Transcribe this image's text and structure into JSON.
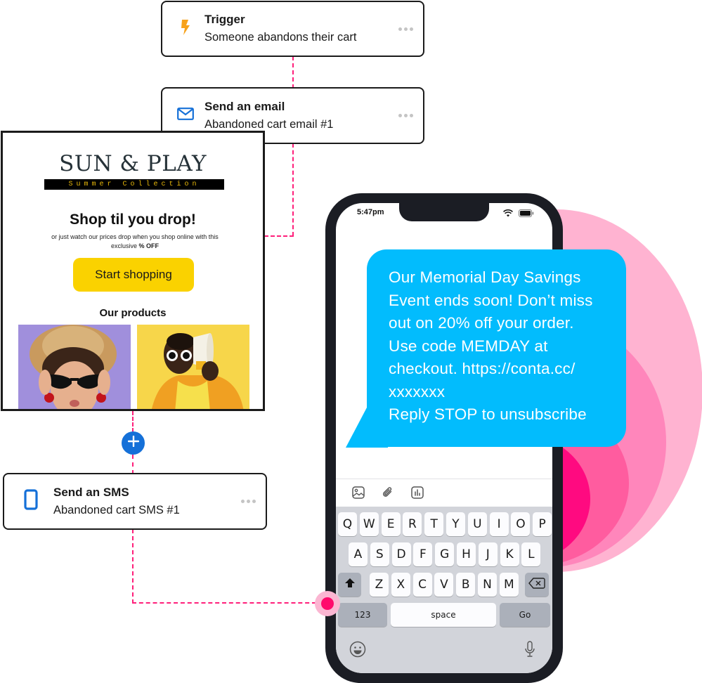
{
  "colors": {
    "connector": "#ff1f7a",
    "accent_blue": "#1570d8",
    "trigger_orange": "#f7a21b",
    "bubble_blue": "#02bcfd",
    "button_yellow": "#fad200",
    "ring_colors": [
      "#ffb3d1",
      "#ff86bb",
      "#ff5c9f",
      "#ff0a80"
    ]
  },
  "workflow": {
    "steps": [
      {
        "icon": "lightning-bolt-icon",
        "title": "Trigger",
        "subtitle": "Someone abandons their cart"
      },
      {
        "icon": "envelope-icon",
        "title": "Send an email",
        "subtitle": "Abandoned cart email #1"
      },
      {
        "icon": "mobile-phone-icon",
        "title": "Send an SMS",
        "subtitle": "Abandoned cart SMS #1"
      }
    ],
    "more_icon": "ellipsis-icon",
    "add_step_icon": "plus-icon"
  },
  "email_preview": {
    "brand_name": "SUN & PLAY",
    "brand_tagline": "Summer Collection",
    "headline": "Shop til you drop!",
    "blurb_prefix": "or just watch our prices drop when you shop online with this exclusive",
    "blurb_bold": "% OFF",
    "cta_label": "Start shopping",
    "products_heading": "Our products",
    "products": [
      {
        "alt": "Woman in straw hat with cat-eye sunglasses"
      },
      {
        "alt": "Man in round white sunglasses holding megaphone"
      }
    ]
  },
  "phone": {
    "status_time": "5:47pm",
    "status_icons": [
      "wifi-icon",
      "battery-icon"
    ],
    "message": "Our Memorial Day Savings\nEvent ends soon! Don’t miss\nout on 20% off your order.\nUse code MEMDAY at\ncheckout. https://conta.cc/\nxxxxxxx\nReply STOP to unsubscribe",
    "compose_tools": [
      "image-icon",
      "paperclip-icon",
      "chart-icon"
    ],
    "keyboard": {
      "row1": [
        "Q",
        "W",
        "E",
        "R",
        "T",
        "Y",
        "U",
        "I",
        "O",
        "P"
      ],
      "row2": [
        "A",
        "S",
        "D",
        "F",
        "G",
        "H",
        "J",
        "K",
        "L"
      ],
      "row3": [
        "Z",
        "X",
        "C",
        "V",
        "B",
        "N",
        "M"
      ],
      "numbers_label": "123",
      "space_label": "space",
      "go_label": "Go",
      "shift_icon": "shift-icon",
      "backspace_icon": "backspace-icon",
      "emoji_icon": "emoji-icon",
      "mic_icon": "microphone-icon"
    }
  }
}
